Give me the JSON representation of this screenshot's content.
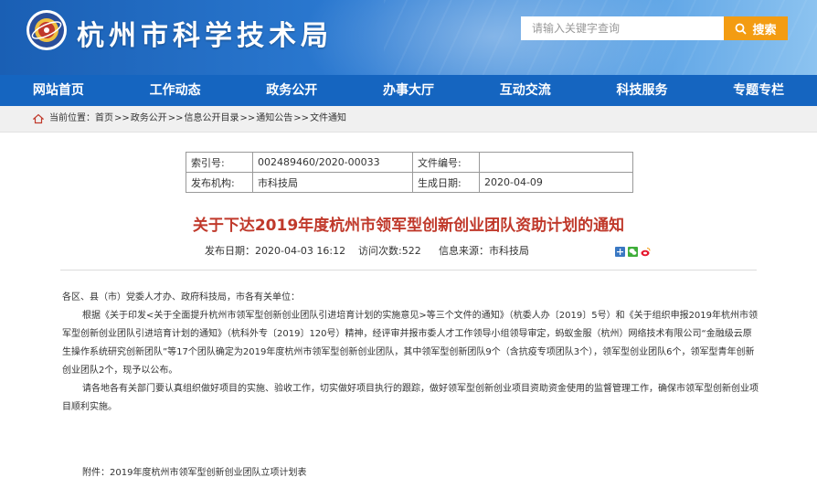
{
  "header": {
    "site_title": "杭州市科学技术局",
    "search_placeholder": "请输入关键字查询",
    "search_button": "搜索"
  },
  "nav": {
    "items": [
      "网站首页",
      "工作动态",
      "政务公开",
      "办事大厅",
      "互动交流",
      "科技服务",
      "专题专栏"
    ]
  },
  "breadcrumb": {
    "prefix": "当前位置：",
    "items": [
      "首页",
      "政务公开",
      "信息公开目录",
      "通知公告",
      "文件通知"
    ],
    "separator": ">>"
  },
  "info_table": {
    "index_label": "索引号:",
    "index_value": "002489460/2020-00033",
    "doc_no_label": "文件编号:",
    "doc_no_value": "",
    "issuer_label": "发布机构:",
    "issuer_value": "市科技局",
    "date_label": "生成日期:",
    "date_value": "2020-04-09"
  },
  "article": {
    "title": "关于下达2019年度杭州市领军型创新创业团队资助计划的通知",
    "publish_date": "发布日期：2020-04-03 16:12",
    "visits": "访问次数:522",
    "source": "信息来源：市科技局",
    "salutation": "各区、县（市）党委人才办、政府科技局，市各有关单位：",
    "para1": "根据《关于印发<关于全面提升杭州市领军型创新创业团队引进培育计划的实施意见>等三个文件的通知》（杭委人办〔2019〕5号）和《关于组织申报2019年杭州市领军型创新创业团队引进培育计划的通知》（杭科外专〔2019〕120号）精神，经评审并报市委人才工作领导小组领导审定，蚂蚁金服（杭州）网络技术有限公司“金融级云原生操作系统研究创新团队”等17个团队确定为2019年度杭州市领军型创新创业团队，其中领军型创新团队9个（含抗疫专项团队3个），领军型创业团队6个，领军型青年创新创业团队2个，现予以公布。",
    "para2": "请各地各有关部门要认真组织做好项目的实施、验收工作，切实做好项目执行的跟踪，做好领军型创新创业项目资助资金使用的监督管理工作，确保市领军型创新创业项目顺利实施。",
    "attachment": "附件：2019年度杭州市领军型创新创业团队立项计划表"
  },
  "colors": {
    "banner": "#1a5fb4",
    "nav": "#1565c0",
    "accent_orange": "#f39c12",
    "title_red": "#c0392b"
  },
  "icons": [
    "emblem-logo",
    "search-icon",
    "home-icon",
    "share-plus-icon",
    "wechat-icon",
    "weibo-icon"
  ]
}
